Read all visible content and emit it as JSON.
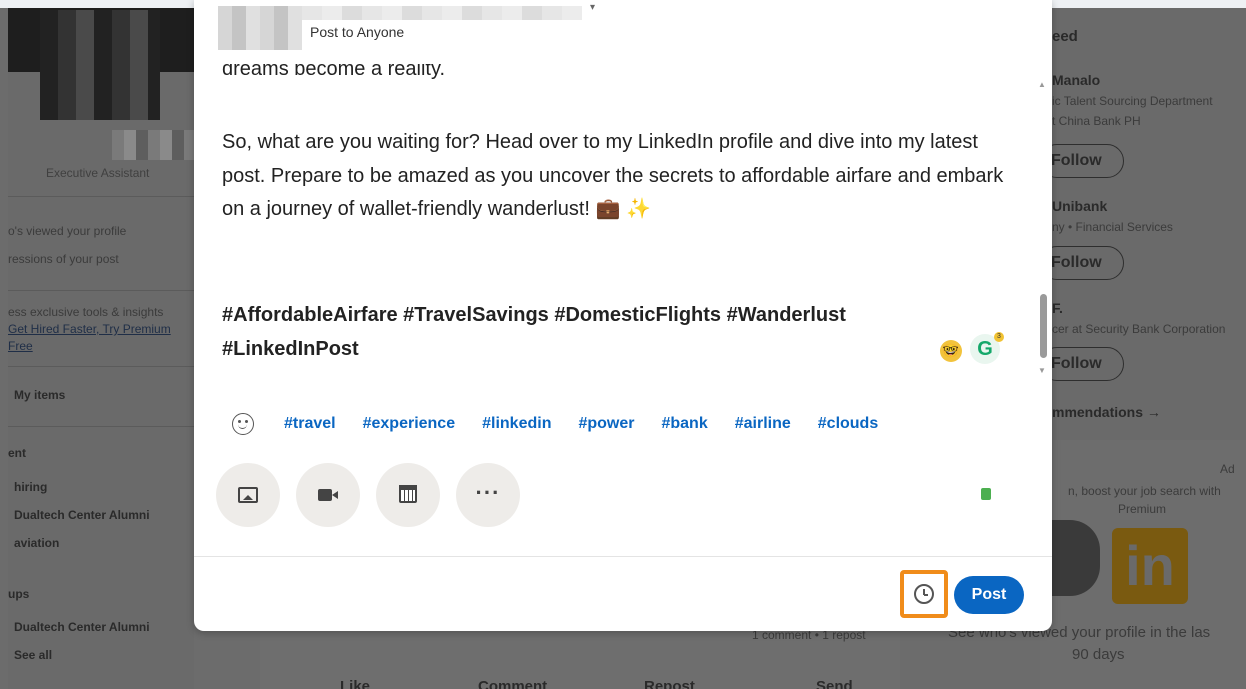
{
  "modal": {
    "post_visibility": "Post to Anyone",
    "editor": {
      "cut_line": "dreams become a reality.",
      "paragraph": "So, what are you waiting for? Head over to my LinkedIn profile and dive into my latest post. Prepare to be amazed as you uncover the secrets to affordable airfare and embark on a journey of wallet-friendly wanderlust! 💼 ✨",
      "hashtags_line1": "#AffordableAirfare #TravelSavings #DomesticFlights #Wanderlust",
      "hashtags_line2": "#LinkedInPost"
    },
    "suggested_hashtags": [
      "#travel",
      "#experience",
      "#linkedin",
      "#power",
      "#bank",
      "#airline",
      "#clouds"
    ],
    "grammarly_label": "G",
    "grammarly_badge": "3",
    "more_label": "···",
    "post_label": "Post"
  },
  "background": {
    "left": {
      "headline": "Executive Assistant",
      "viewed_profile": "o's viewed your profile",
      "impressions": "ressions of your post",
      "premium_text": "ess exclusive tools & insights",
      "premium_link": "Get Hired Faster, Try Premium",
      "premium_link2": "Free",
      "my_items": "My items",
      "recent_heading": "ent",
      "recent": [
        "hiring",
        "Dualtech Center Alumni",
        "aviation"
      ],
      "groups_heading": "ups",
      "groups": [
        "Dualtech Center Alumni",
        "See all"
      ]
    },
    "right": {
      "feed_heading": "eed",
      "people": [
        {
          "name": "Manalo",
          "line1": "ic Talent Sourcing Department",
          "line2": "t China Bank PH"
        },
        {
          "name": "Unibank",
          "line1": "ny • Financial Services",
          "line2": ""
        },
        {
          "name": "F.",
          "line1": "cer at Security Bank Corporation",
          "line2": ""
        }
      ],
      "follow_label": "Follow",
      "recommendations": "mmendations →",
      "ad_label": "Ad",
      "ad_text1": "n, boost your job search with",
      "ad_text2": "Premium",
      "ad_logo": "in",
      "ad_bottom1": "See who's viewed your profile in the las",
      "ad_bottom2": "90 days"
    },
    "feed": {
      "comments": "1 comment • 1 repost",
      "like": "Like",
      "comment": "Comment",
      "repost": "Repost",
      "send": "Send"
    }
  }
}
